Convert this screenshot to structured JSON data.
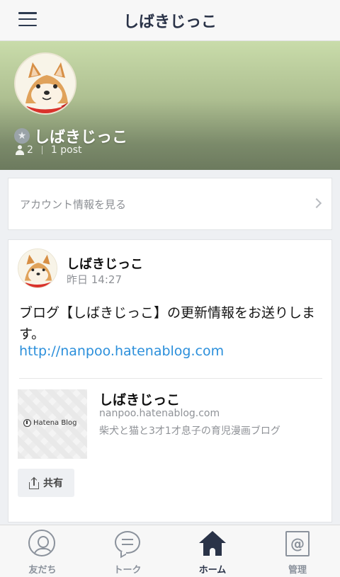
{
  "header": {
    "title": "しばきじっこ"
  },
  "profile": {
    "name": "しばきじっこ",
    "followers": "2",
    "posts": "1 post",
    "badge_icon": "star-icon"
  },
  "account_link": {
    "label": "アカウント情報を見る"
  },
  "post": {
    "author": "しばきじっこ",
    "time": "昨日 14:27",
    "text": "ブログ【しばきじっこ】の更新情報をお送りします。",
    "link": "http://nanpoo.hatenablog.com",
    "preview": {
      "title": "しばきじっこ",
      "domain": "nanpoo.hatenablog.com",
      "description": "柴犬と猫と3才1才息子の育児漫画ブログ",
      "logo_text": "Hatena Blog"
    },
    "share_label": "共有"
  },
  "nav": {
    "friends": "友だち",
    "talk": "トーク",
    "home": "ホーム",
    "manage": "管理",
    "active": "home"
  },
  "colors": {
    "accent_dark": "#2a3348",
    "link": "#2b8fdb",
    "muted": "#8b929c"
  }
}
